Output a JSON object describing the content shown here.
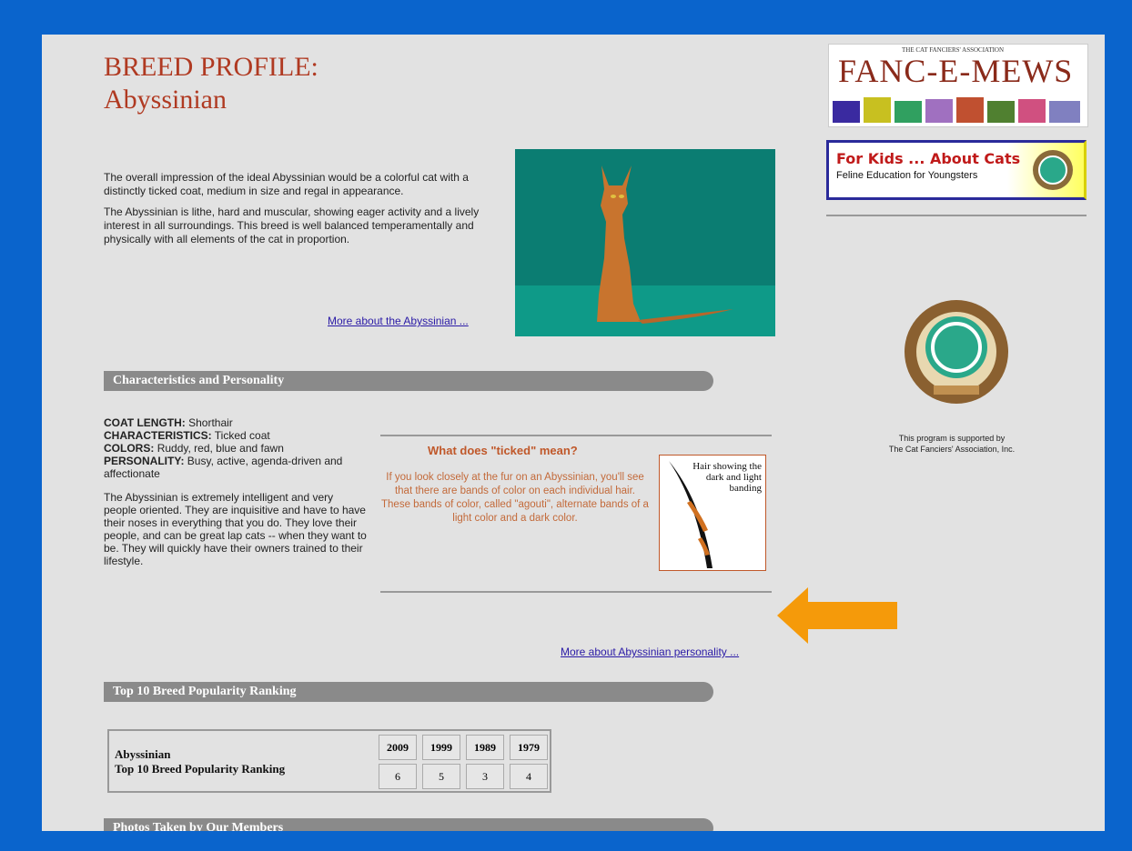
{
  "page": {
    "title_line1": "BREED PROFILE:",
    "title_line2": "Abyssinian"
  },
  "intro": {
    "p1": "The overall impression of the ideal Abyssinian would be a colorful cat with a distinctly ticked coat, medium in size and regal in appearance.",
    "p2": "The Abyssinian is lithe, hard and muscular, showing eager activity and a lively interest in all surroundings. This breed is well balanced temperamentally and physically with all elements of the cat in proportion.",
    "more_link": "More about the Abyssinian ..."
  },
  "sections": {
    "characteristics": "Characteristics and Personality",
    "ranking": "Top 10 Breed Popularity Ranking",
    "photos": "Photos Taken by Our Members"
  },
  "characteristics": {
    "coat_label": "COAT LENGTH:",
    "coat_value": "Shorthair",
    "char_label": "CHARACTERISTICS:",
    "char_value": "Ticked coat",
    "colors_label": "COLORS:",
    "colors_value": "Ruddy, red, blue and fawn",
    "pers_label": "PERSONALITY:",
    "pers_value": "Busy, active, agenda-driven and affectionate",
    "desc": "The Abyssinian is extremely intelligent and very people oriented. They are inquisitive and have to have their noses in everything that you do. They love their people, and can be great lap cats -- when they want to be. They will quickly have their owners trained to their lifestyle.",
    "more_link": "More about Abyssinian personality ..."
  },
  "ticked": {
    "heading": "What does \"ticked\" mean?",
    "text": "If you look closely at the fur on an Abyssinian, you'll see that there are bands of color on each individual hair. These bands of color, called \"agouti\", alternate bands of a light color and a dark color.",
    "caption": "Hair showing the dark and light banding"
  },
  "ranking": {
    "label_line1": "Abyssinian",
    "label_line2": "Top 10 Breed Popularity Ranking",
    "years": [
      "2009",
      "1999",
      "1989",
      "1979"
    ],
    "ranks": [
      "6",
      "5",
      "3",
      "4"
    ]
  },
  "sidebar": {
    "fanc_small": "THE CAT FANCIERS' ASSOCIATION",
    "fanc_title": "FANC-E-MEWS",
    "kids_title": "For Kids ... About Cats",
    "kids_sub": "Feline Education for Youngsters",
    "cfa_note_line1": "This program is supported by",
    "cfa_note_line2": "The Cat Fanciers' Association, Inc."
  },
  "colors": {
    "accent_title": "#b03a22",
    "link": "#2a1aa6",
    "bar": "#8a8a8a",
    "arrow": "#f59a0a"
  }
}
